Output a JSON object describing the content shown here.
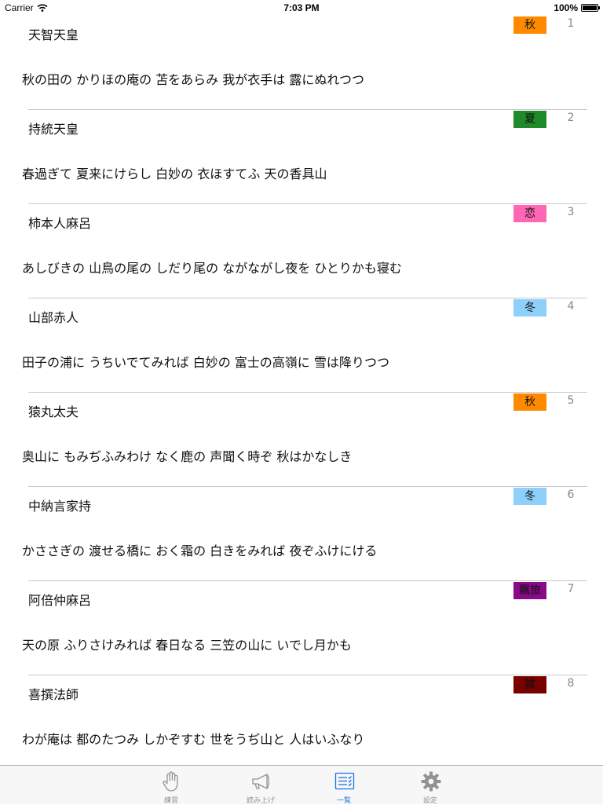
{
  "status_bar": {
    "carrier": "Carrier",
    "time": "7:03 PM",
    "battery": "100%",
    "battery_level": 1.0
  },
  "poems": [
    {
      "author": "天智天皇",
      "category": "秋",
      "category_color": "#ff8a00",
      "number": "1",
      "text": "秋の田の かりほの庵の 苫をあらみ 我が衣手は 露にぬれつつ"
    },
    {
      "author": "持統天皇",
      "category": "夏",
      "category_color": "#1e8a2a",
      "number": "2",
      "text": "春過ぎて 夏来にけらし 白妙の 衣ほすてふ 天の香具山"
    },
    {
      "author": "柿本人麻呂",
      "category": "恋",
      "category_color": "#ff66b3",
      "number": "3",
      "text": "あしびきの 山鳥の尾の しだり尾の ながながし夜を ひとりかも寝む"
    },
    {
      "author": "山部赤人",
      "category": "冬",
      "category_color": "#8ed0fa",
      "number": "4",
      "text": "田子の浦に うちいでてみれば 白妙の 富士の高嶺に 雪は降りつつ"
    },
    {
      "author": "猿丸太夫",
      "category": "秋",
      "category_color": "#ff8a00",
      "number": "5",
      "text": "奥山に もみぢふみわけ なく鹿の 声聞く時ぞ 秋はかなしき"
    },
    {
      "author": "中納言家持",
      "category": "冬",
      "category_color": "#8ed0fa",
      "number": "6",
      "text": "かささぎの 渡せる橋に おく霜の 白きをみれば 夜ぞふけにける"
    },
    {
      "author": "阿倍仲麻呂",
      "category": "羈旅",
      "category_color": "#8a0a8a",
      "number": "7",
      "text": "天の原 ふりさけみれば 春日なる 三笠の山に いでし月かも"
    },
    {
      "author": "喜撰法師",
      "category": "雑",
      "category_color": "#7a0000",
      "number": "8",
      "text": "わが庵は 都のたつみ しかぞすむ 世をうぢ山と 人はいふなり"
    }
  ],
  "tab_bar": {
    "tabs": [
      {
        "label": "練習",
        "icon": "hand-icon",
        "active": false
      },
      {
        "label": "読み上げ",
        "icon": "megaphone-icon",
        "active": false
      },
      {
        "label": "一覧",
        "icon": "list-icon",
        "active": true
      },
      {
        "label": "設定",
        "icon": "gear-icon",
        "active": false
      }
    ],
    "active_color": "#1a73e8",
    "inactive_color": "#929292"
  }
}
